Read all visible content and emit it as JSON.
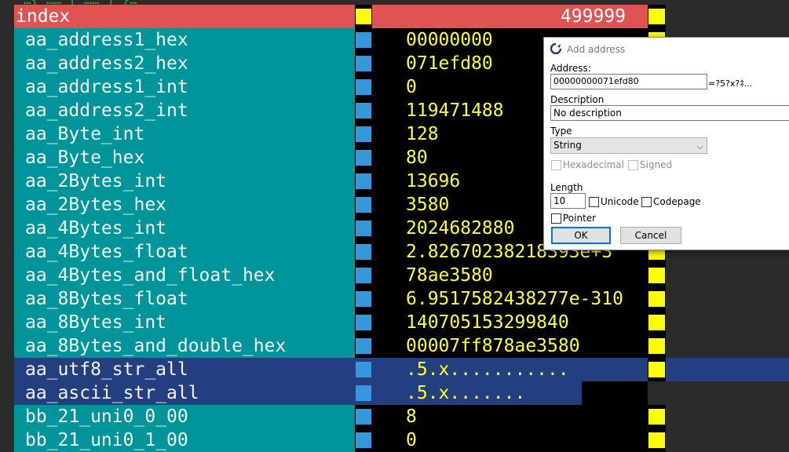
{
  "window": {
    "top_fragment": "…{ …… [ …… ] }…"
  },
  "table": {
    "header": {
      "name": "index",
      "value": "499999"
    },
    "rows": [
      {
        "name": "aa_address1_hex",
        "value": "00000000"
      },
      {
        "name": "aa_address2_hex",
        "value": "071efd80"
      },
      {
        "name": "aa_address1_int",
        "value": "0"
      },
      {
        "name": "aa_address2_int",
        "value": "119471488"
      },
      {
        "name": "aa_Byte_int",
        "value": "128"
      },
      {
        "name": "aa_Byte_hex",
        "value": "80"
      },
      {
        "name": "aa_2Bytes_int",
        "value": "13696"
      },
      {
        "name": "aa_2Bytes_hex",
        "value": "3580"
      },
      {
        "name": "aa_4Bytes_int",
        "value": "2024682880"
      },
      {
        "name": "aa_4Bytes_float",
        "value": "2.82670238218393e+3"
      },
      {
        "name": "aa_4Bytes_and_float_hex",
        "value": "78ae3580"
      },
      {
        "name": "aa_8Bytes_float",
        "value": "6.9517582438277e-310"
      },
      {
        "name": "aa_8Bytes_int",
        "value": "140705153299840"
      },
      {
        "name": "aa_8Bytes_and_double_hex",
        "value": "00007ff878ae3580"
      },
      {
        "name": "aa_utf8_str_all",
        "value": ".5.x..........."
      },
      {
        "name": "aa_ascii_str_all",
        "value": ".5.x......."
      },
      {
        "name": "bb_21_uni0_0_00",
        "value": "8"
      },
      {
        "name": "bb_21_uni0_1_00",
        "value": "0"
      }
    ]
  },
  "dialog": {
    "title": "Add address",
    "address_label": "Address:",
    "address_value": "00000000071efd80",
    "address_preview": "=?5?x?ﾈ...",
    "description_label": "Description",
    "description_value": "No description",
    "type_label": "Type",
    "type_value": "String",
    "hexadecimal_label": "Hexadecimal",
    "signed_label": "Signed",
    "length_label": "Length",
    "length_value": "10",
    "unicode_label": "Unicode",
    "codepage_label": "Codepage",
    "pointer_label": "Pointer",
    "ok_label": "OK",
    "cancel_label": "Cancel"
  },
  "colors": {
    "header_red": "#e05353",
    "teal": "#00959a",
    "selection_blue": "#233f7f",
    "value_yellow": "#ffff2e",
    "marker_blue": "#3598dc",
    "marker_yellow": "#ffff00"
  }
}
